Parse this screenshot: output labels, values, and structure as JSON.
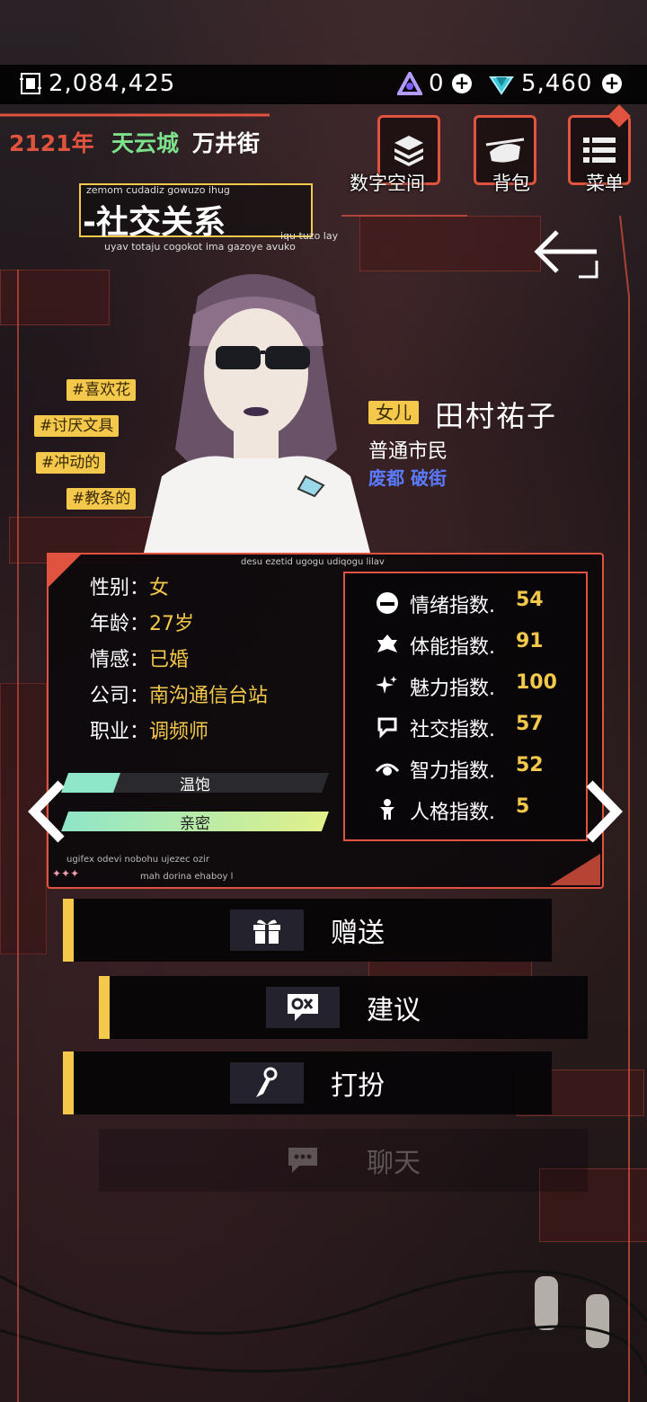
{
  "top_bar": {
    "money_icon": "chip-icon",
    "money": "2,084,425",
    "currency_a": {
      "icon": "triangle-gem-icon",
      "value": "0"
    },
    "currency_b": {
      "icon": "diamond-gem-icon",
      "value": "5,460"
    }
  },
  "location": {
    "year": "2121年",
    "city": "天云城",
    "street": "万井街"
  },
  "nav": {
    "digital_space": "数字空间",
    "backpack": "背包",
    "menu": "菜单"
  },
  "section": {
    "title": "-社交关系",
    "glyph_top": "zemom cudadiz gowuzo ihug",
    "glyph_right": "iqu tuzo lay",
    "glyph_bottom": "uyav totaju cogokot ima gazoye avuko"
  },
  "traits": [
    "#喜欢花",
    "#讨厌文具",
    "#冲动的",
    "#教条的"
  ],
  "character": {
    "relation": "女儿",
    "name": "田村祐子",
    "class": "普通市民",
    "district": "废都 破街"
  },
  "panel_glyphs": {
    "top": "desu ezetid ugogu udiqogu lilav",
    "bottom1": "ugifex odevi nobohu ujezec ozir",
    "bottom2": "mah dorina ehaboy l",
    "stars": "✦✦✦"
  },
  "profile": [
    {
      "key": "性别",
      "sep": "：",
      "value": "女"
    },
    {
      "key": "年龄",
      "sep": "：",
      "value": "27岁"
    },
    {
      "key": "情感",
      "sep": "：",
      "value": "已婚"
    },
    {
      "key": "公司",
      "sep": "：",
      "value": "南沟通信台站"
    },
    {
      "key": "职业",
      "sep": "：",
      "value": "调频师"
    }
  ],
  "bars": [
    {
      "label": "温饱",
      "fill": 0.2
    },
    {
      "label": "亲密",
      "fill": 1.0
    }
  ],
  "stats": [
    {
      "icon": "mood-icon",
      "label": "情绪指数.",
      "value": "54"
    },
    {
      "icon": "stamina-icon",
      "label": "体能指数.",
      "value": "91"
    },
    {
      "icon": "sparkle-icon",
      "label": "魅力指数.",
      "value": "100"
    },
    {
      "icon": "social-icon",
      "label": "社交指数.",
      "value": "57"
    },
    {
      "icon": "eye-icon",
      "label": "智力指数.",
      "value": "52"
    },
    {
      "icon": "person-icon",
      "label": "人格指数.",
      "value": "5"
    }
  ],
  "actions": [
    {
      "icon": "gift-icon",
      "label": "赠送"
    },
    {
      "icon": "suggest-icon",
      "label": "建议"
    },
    {
      "icon": "dress-icon",
      "label": "打扮"
    },
    {
      "icon": "chat-icon",
      "label": "聊天"
    }
  ],
  "colors": {
    "accent": "#e0533e",
    "gold": "#f3c84b",
    "green": "#7de08a",
    "blue": "#5a7bff",
    "mint": "#8fe6c8"
  }
}
